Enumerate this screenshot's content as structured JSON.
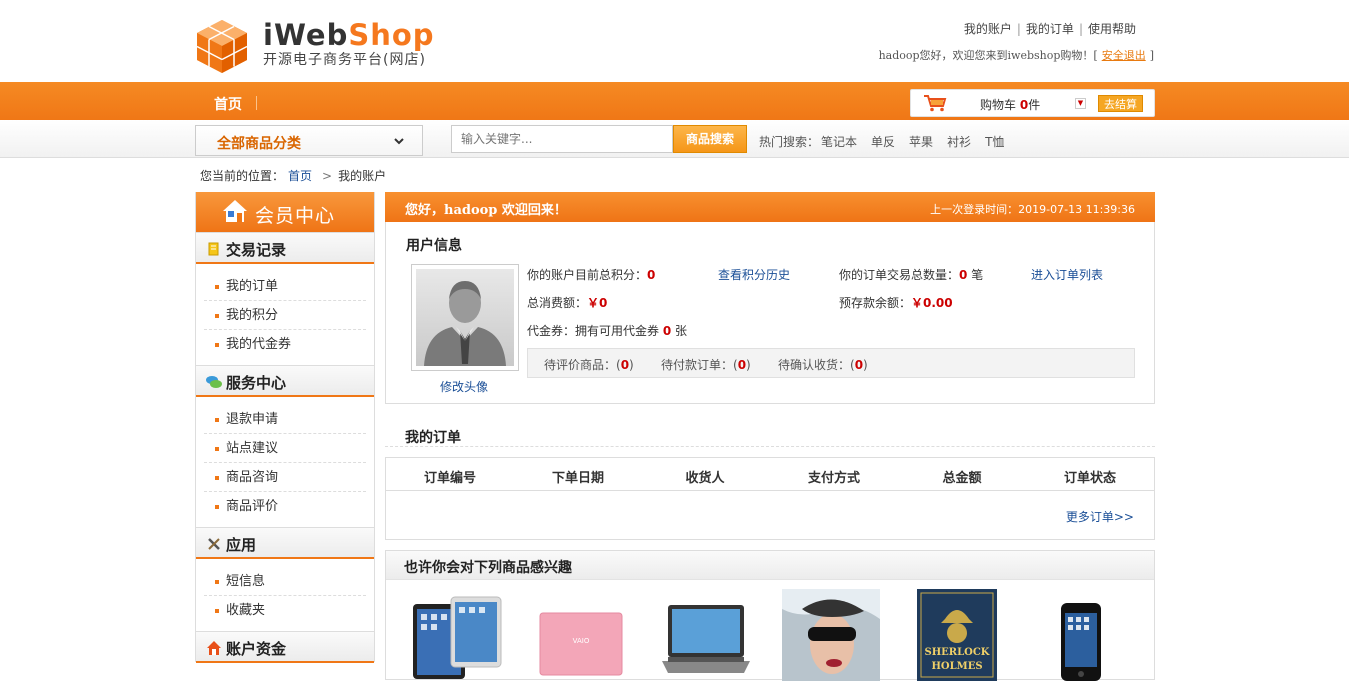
{
  "header": {
    "logo_main": "iWeb",
    "logo_accent": "Shop",
    "logo_sub": "开源电子商务平台(网店)",
    "top_links": [
      "我的账户",
      "我的订单",
      "使用帮助"
    ],
    "welcome_text": "hadoop您好，欢迎您来到iwebshop购物！[",
    "logout": "安全退出",
    "welcome_end": "]"
  },
  "nav": {
    "home": "首页",
    "cart_label": "购物车",
    "cart_count": "0",
    "cart_unit": "件",
    "checkout": "去结算"
  },
  "search": {
    "category_label": "全部商品分类",
    "placeholder": "输入关键字...",
    "button": "商品搜索",
    "hot_label": "热门搜索：",
    "hot_keywords": [
      "笔记本",
      "单反",
      "苹果",
      "衬衫",
      "T恤"
    ]
  },
  "breadcrumb": {
    "prefix": "您当前的位置：",
    "home": "首页",
    "sep": ">",
    "current": "我的账户"
  },
  "sidebar": {
    "title": "会员中心",
    "sections": [
      {
        "title": "交易记录",
        "items": [
          "我的订单",
          "我的积分",
          "我的代金券"
        ]
      },
      {
        "title": "服务中心",
        "items": [
          "退款申请",
          "站点建议",
          "商品咨询",
          "商品评价"
        ]
      },
      {
        "title": "应用",
        "items": [
          "短信息",
          "收藏夹"
        ]
      },
      {
        "title": "账户资金",
        "items": []
      }
    ]
  },
  "main": {
    "greeting": "您好，hadoop 欢迎回来！",
    "last_login_label": "上一次登录时间：",
    "last_login": "2019-07-13 11:39:36",
    "user_info_title": "用户信息",
    "edit_avatar": "修改头像",
    "points_label": "你的账户目前总积分：",
    "points": "0",
    "points_history": "查看积分历史",
    "orders_count_label": "你的订单交易总数量：",
    "orders_count": "0",
    "orders_count_unit": "笔",
    "orders_list_link": "进入订单列表",
    "spent_label": "总消费额：",
    "spent": "￥0",
    "balance_label": "预存款余额：",
    "balance": "￥0.00",
    "voucher_label": "代金券：拥有可用代金券",
    "voucher": "0",
    "voucher_unit": "张",
    "pending": [
      {
        "label": "待评价商品：(",
        "value": "0",
        "end": ")"
      },
      {
        "label": "待付款订单：(",
        "value": "0",
        "end": ")"
      },
      {
        "label": "待确认收货：(",
        "value": "0",
        "end": ")"
      }
    ],
    "orders_title": "我的订单",
    "orders_columns": [
      "订单编号",
      "下单日期",
      "收货人",
      "支付方式",
      "总金额",
      "订单状态"
    ],
    "more_orders": "更多订单>>",
    "recommend_title": "也许你会对下列商品感兴趣",
    "products": [
      "ipad-image",
      "pink-laptop-image",
      "laptop-image",
      "album-cover-image",
      "book-cover-image",
      "iphone-image"
    ],
    "book_text": "SHERLOCK HOLMES",
    "colors": {
      "accent": "#f07716",
      "link": "#1b4f97",
      "red": "#cc0000"
    }
  }
}
